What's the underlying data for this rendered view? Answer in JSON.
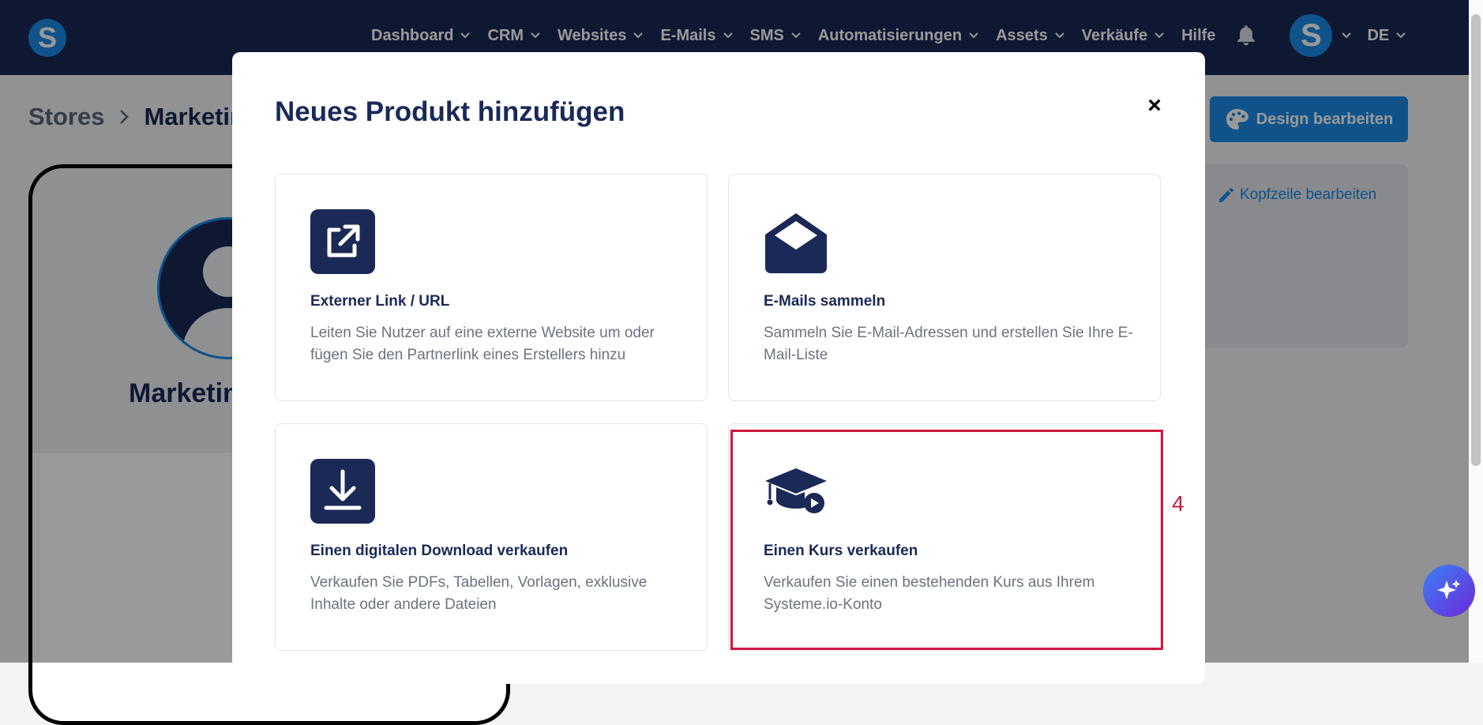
{
  "app": {
    "logo_letter": "S",
    "avatar_letter": "S"
  },
  "nav": {
    "items": [
      "Dashboard",
      "CRM",
      "Websites",
      "E-Mails",
      "SMS",
      "Automatisierungen",
      "Assets",
      "Verkäufe"
    ],
    "help": "Hilfe",
    "language": "DE"
  },
  "page": {
    "breadcrumb_root": "Stores",
    "breadcrumb_current": "Marketin",
    "design_button": "Design bearbeiten",
    "header_edit_link": "Kopfzeile bearbeiten",
    "store_name": "Marketin"
  },
  "modal": {
    "title": "Neues Produkt hinzufügen",
    "close": "×",
    "cards": [
      {
        "icon": "external-link-icon",
        "title": "Externer Link / URL",
        "description": "Leiten Sie Nutzer auf eine externe Website um oder fügen Sie den Partnerlink eines Erstellers hinzu"
      },
      {
        "icon": "envelope-open-icon",
        "title": "E-Mails sammeln",
        "description": "Sammeln Sie E-Mail-Adressen und erstellen Sie Ihre E-Mail-Liste"
      },
      {
        "icon": "download-icon",
        "title": "Einen digitalen Download verkaufen",
        "description": "Verkaufen Sie PDFs, Tabellen, Vorlagen, exklusive Inhalte oder andere Dateien"
      },
      {
        "icon": "graduation-cap-icon",
        "title": "Einen Kurs verkaufen",
        "description": "Verkaufen Sie einen bestehenden Kurs aus Ihrem Systeme.io-Konto"
      }
    ]
  },
  "annotation": {
    "label": "4",
    "color": "#d0173f"
  },
  "colors": {
    "navy": "#1a2956",
    "accent": "#1a8ae6",
    "text_muted": "#6b7280"
  }
}
